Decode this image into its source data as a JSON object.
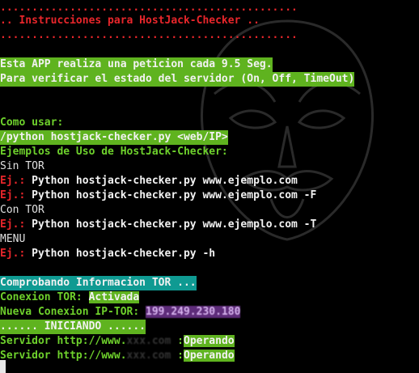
{
  "banner": {
    "border_line": "...............................................",
    "title_line": ".. Instrucciones para HostJack-Checker .."
  },
  "info": {
    "line1": "Esta APP realiza una peticion cada 9.5 Seg.",
    "line2": "Para verificar el estado del servidor (On, Off, TimeOut)"
  },
  "usage": {
    "heading": "Como usar:",
    "syntax": "/python hostjack-checker.py <web/IP>",
    "examples_heading": "Ejemplos de Uso de HostJack-Checker:",
    "sin_tor": "Sin TOR",
    "con_tor": "Con TOR",
    "menu": "MENU",
    "ej_prefix": "Ej.:",
    "example1": " Python hostjack-checker.py www.ejemplo.com",
    "example2": " Python hostjack-checker.py www.ejemplo.com -F",
    "example3": " Python hostjack-checker.py www.ejemplo.com -T",
    "example4": " Python hostjack-checker.py -h"
  },
  "status": {
    "checking_tor": "Comprobando Informacion TOR ...",
    "conexion_label": "Conexion TOR:",
    "conexion_value": "Activada",
    "ip_label": "Nueva Conexion IP-TOR:",
    "ip_value": "199.249.230.180",
    "starting": "...... INICIANDO ......",
    "server_prefix": "Servidor http://www.",
    "server_host_hidden": "xxx.com",
    "server_sep": " :",
    "server_status": "Operando"
  },
  "colors": {
    "red": "#e8262b",
    "green_text": "#6ed12c",
    "green_bg": "#5fb31f",
    "cyan_bg": "#0f9a92",
    "purple_bg": "#5e2c7a"
  }
}
